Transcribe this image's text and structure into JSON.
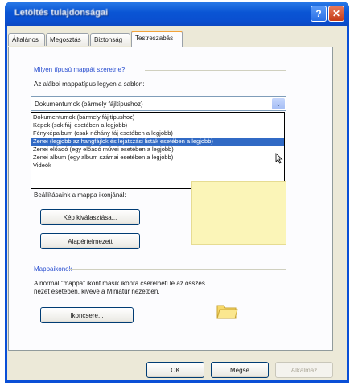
{
  "window": {
    "title": "Letöltés tulajdonságai",
    "help_glyph": "?",
    "close_glyph": "✕"
  },
  "tabs": [
    {
      "label": "Általános"
    },
    {
      "label": "Megosztás"
    },
    {
      "label": "Biztonság"
    },
    {
      "label": "Testreszabás",
      "active": true
    }
  ],
  "template_section": {
    "heading": "Milyen típusú mappát szeretne?",
    "prompt": "Az alábbi mappatípus legyen a sablon:",
    "selected": "Dokumentumok (bármely fájltípushoz)",
    "arrow_glyph": "⌄",
    "options": [
      "Dokumentumok (bármely fájltípushoz)",
      "Képek (sok fájl esetében a legjobb)",
      "Fényképalbum (csak néhány fáj esetében a legjobb)",
      "Zenei (legjobb az hangfájlok és lejátszási listák esetében a legjobb)",
      "Zenei előadó (egy előadó művei esetében a legjobb)",
      "Zenei album (egy album számai esetében a legjobb)",
      "Videók"
    ],
    "selected_option_index": 3
  },
  "picture_section": {
    "partial_text": "Beállításaink a mappa ikonjánál:",
    "choose_button": "Kép kiválasztása...",
    "restore_button": "Alapértelmezett"
  },
  "icons_section": {
    "heading": "Mappaikonok",
    "description_line1": "A normál \"mappa\" ikont másik ikonra cserélheti le az összes",
    "description_line2": "nézet esetében, kivéve a Miniatűr nézetben.",
    "change_button": "Ikoncsere..."
  },
  "footer": {
    "ok": "OK",
    "cancel": "Mégse",
    "apply": "Alkalmaz"
  },
  "colors": {
    "titlebar": "#0a55d4",
    "selection": "#316ac5",
    "preview": "#fbf5b8",
    "active_tab_accent": "#f3a33a"
  }
}
